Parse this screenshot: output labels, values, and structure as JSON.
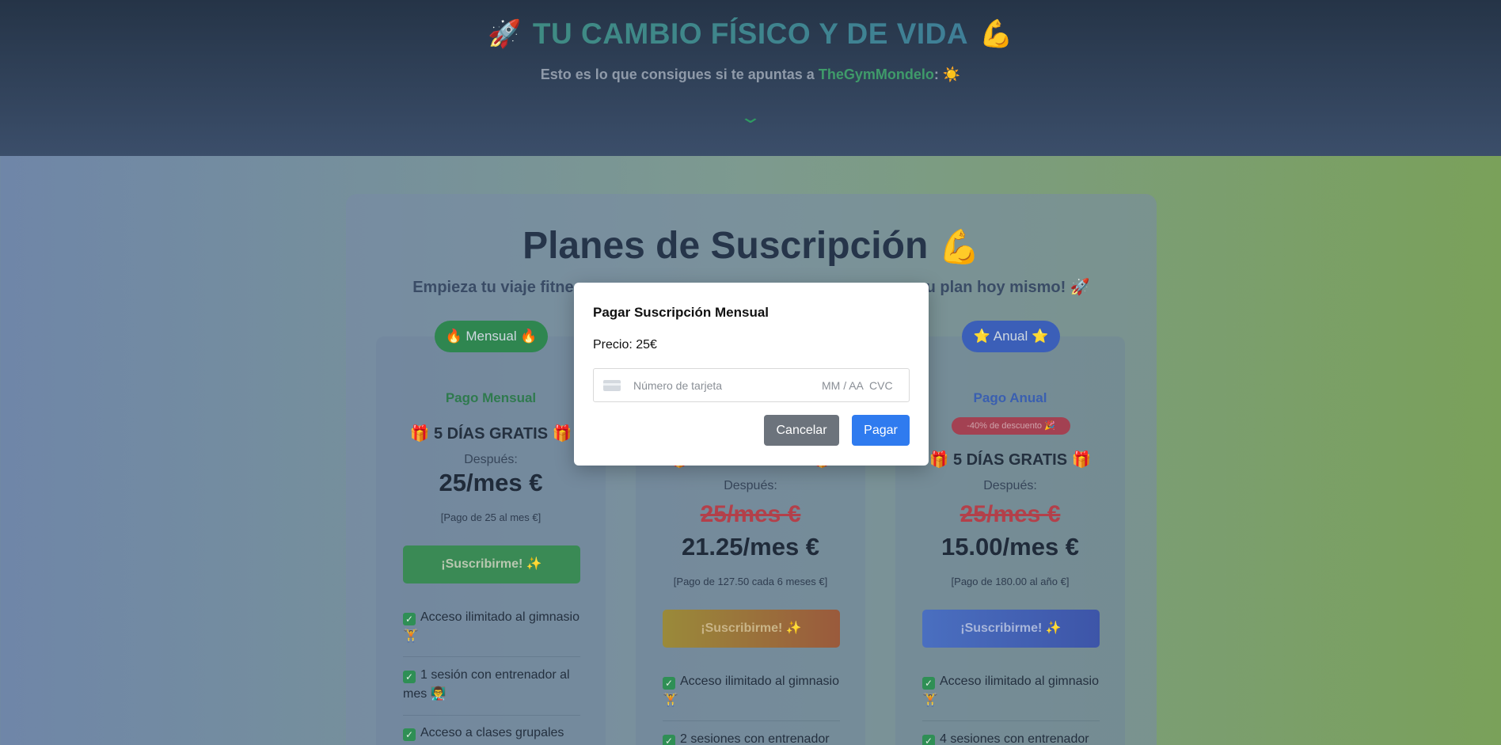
{
  "hero": {
    "rocket": "🚀",
    "title": "TU CAMBIO FÍSICO Y DE VIDA",
    "arm": "💪",
    "subtitle_pre": "Esto es lo que consigues si te apuntas a",
    "brand": "TheGymMondelo",
    "subtitle_post": ":",
    "sun": "☀️",
    "chevron": "⌄"
  },
  "plans_section": {
    "title": "Planes de Suscripción",
    "title_emoji": "💪",
    "subtitle_left": "Empieza tu viaje fitne",
    "subtitle_right": "u plan hoy mismo!",
    "subtitle_emoji": "🚀"
  },
  "plans": [
    {
      "pill": "🔥 Mensual 🔥",
      "name": "Pago Mensual",
      "gift": "🎁 5 DÍAS GRATIS 🎁",
      "after": "Después:",
      "price": "25/mes €",
      "note": "[Pago de 25 al mes €]",
      "button": "¡Suscribirme! ✨",
      "features": [
        "Acceso ilimitado al gimnasio 🏋️",
        "1 sesión con entrenador al mes 👨‍🏫",
        "Acceso a clases grupales"
      ]
    },
    {
      "gift": "🎁 5 DÍAS GRATIS 🎁",
      "after": "Después:",
      "old_price": "25/mes €",
      "price": "21.25/mes €",
      "note": "[Pago de 127.50 cada 6 meses €]",
      "button": "¡Suscribirme! ✨",
      "features": [
        "Acceso ilimitado al gimnasio 🏋️",
        "2 sesiones con entrenador"
      ]
    },
    {
      "pill": "⭐ Anual ⭐",
      "name": "Pago Anual",
      "discount": "-40% de descuento 🎉",
      "gift": "🎁 5 DÍAS GRATIS 🎁",
      "after": "Después:",
      "old_price": "25/mes €",
      "price": "15.00/mes €",
      "note": "[Pago de 180.00 al año €]",
      "button": "¡Suscribirme! ✨",
      "features": [
        "Acceso ilimitado al gimnasio 🏋️",
        "4 sesiones con entrenador"
      ]
    }
  ],
  "modal": {
    "title": "Pagar Suscripción Mensual",
    "price": "Precio: 25€",
    "card_placeholder": "Número de tarjeta",
    "expiry_placeholder": "MM / AA",
    "cvc_placeholder": "CVC",
    "cancel": "Cancelar",
    "pay": "Pagar"
  },
  "colors": {
    "green": "#2f8f55",
    "blue": "#3a5fb0",
    "pay_button": "#2f7bef",
    "cancel_button": "#6c737c"
  }
}
